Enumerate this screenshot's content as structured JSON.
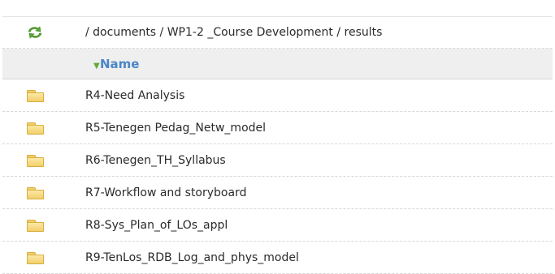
{
  "breadcrumb": "/ documents / WP1-2 _Course Development / results",
  "header": {
    "name_label": "Name",
    "sort_indicator": "▼"
  },
  "rows": [
    {
      "label": "R4-Need Analysis",
      "icon": "folder-icon"
    },
    {
      "label": "R5-Tenegen Pedag_Netw_model",
      "icon": "folder-icon"
    },
    {
      "label": "R6-Tenegen_TH_Syllabus",
      "icon": "folder-icon"
    },
    {
      "label": "R7-Workflow and storyboard",
      "icon": "folder-icon"
    },
    {
      "label": "R8-Sys_Plan_of_LOs_appl",
      "icon": "folder-icon"
    },
    {
      "label": "R9-TenLos_RDB_Log_and_phys_model",
      "icon": "folder-icon"
    }
  ],
  "colors": {
    "header_text": "#4a86c8",
    "folder": "#f2cf6b",
    "refresh": "#5aa832"
  }
}
